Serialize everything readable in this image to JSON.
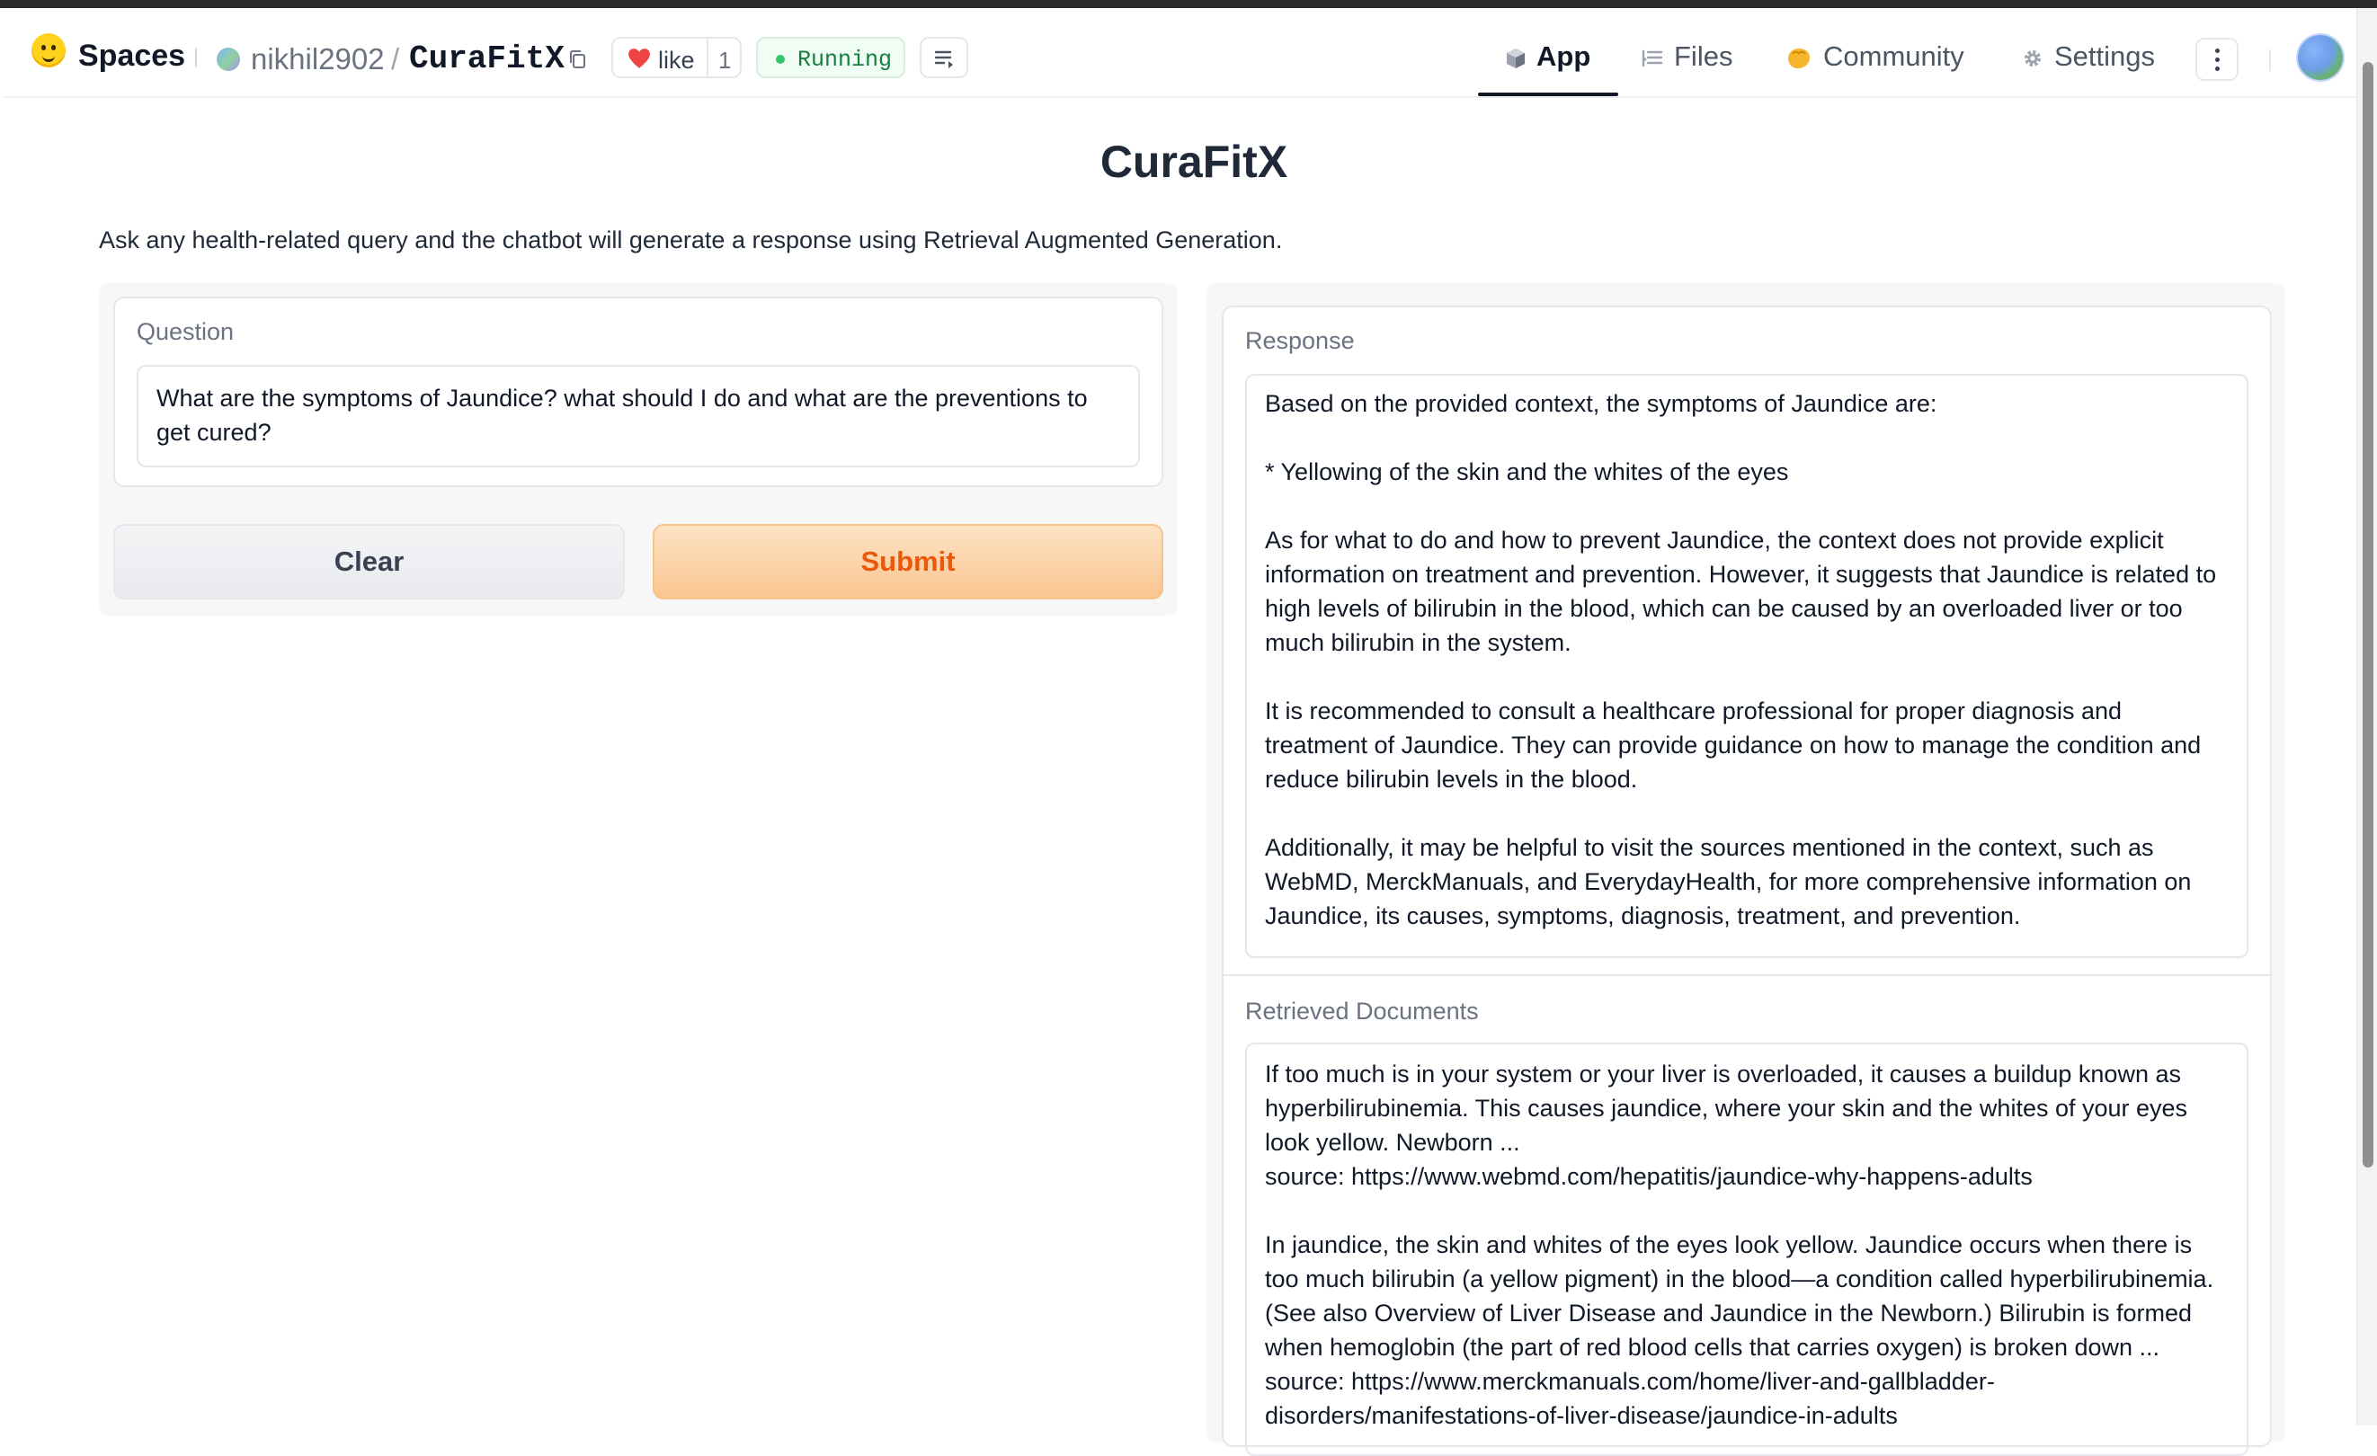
{
  "header": {
    "spaces_label": "Spaces",
    "owner": "nikhil2902",
    "separator": "/",
    "repo": "CuraFitX",
    "like_label": "like",
    "like_count": "1",
    "status": "Running",
    "nav": {
      "app": "App",
      "files": "Files",
      "community": "Community",
      "settings": "Settings"
    }
  },
  "main": {
    "title": "CuraFitX",
    "description": "Ask any health-related query and the chatbot will generate a response using Retrieval Augmented Generation.",
    "question": {
      "label": "Question",
      "value": "What are the symptoms of Jaundice? what should I do and what are the preventions to get cured?"
    },
    "buttons": {
      "clear": "Clear",
      "submit": "Submit"
    },
    "response": {
      "label": "Response",
      "paragraphs": [
        "Based on the provided context, the symptoms of Jaundice are:",
        "* Yellowing of the skin and the whites of the eyes",
        "As for what to do and how to prevent Jaundice, the context does not provide explicit information on treatment and prevention. However, it suggests that Jaundice is related to high levels of bilirubin in the blood, which can be caused by an overloaded liver or too much bilirubin in the system.",
        "It is recommended to consult a healthcare professional for proper diagnosis and treatment of Jaundice. They can provide guidance on how to manage the condition and reduce bilirubin levels in the blood.",
        "Additionally, it may be helpful to visit the sources mentioned in the context, such as WebMD, MerckManuals, and EverydayHealth, for more comprehensive information on Jaundice, its causes, symptoms, diagnosis, treatment, and prevention."
      ]
    },
    "retrieved": {
      "label": "Retrieved Documents",
      "docs": [
        {
          "text": "If too much is in your system or your liver is overloaded, it causes a buildup known as hyperbilirubinemia. This causes jaundice, where your skin and the whites of your eyes look yellow. Newborn ...",
          "source": "source: https://www.webmd.com/hepatitis/jaundice-why-happens-adults"
        },
        {
          "text": "In jaundice, the skin and whites of the eyes look yellow. Jaundice occurs when there is too much bilirubin (a yellow pigment) in the blood—a condition called hyperbilirubinemia. (See also Overview of Liver Disease and Jaundice in the Newborn.) Bilirubin is formed when hemoglobin (the part of red blood cells that carries oxygen) is broken down ...",
          "source": "source: https://www.merckmanuals.com/home/liver-and-gallbladder-disorders/manifestations-of-liver-disease/jaundice-in-adults"
        }
      ]
    }
  },
  "icons": {
    "logo": "hugging-face-logo-icon",
    "copy": "copy-icon",
    "heart": "heart-icon",
    "logs": "logs-icon",
    "app": "cube-icon",
    "files": "files-icon",
    "community": "community-icon",
    "settings": "gear-icon",
    "more": "kebab-menu-icon"
  },
  "colors": {
    "accent_orange": "#ea580c",
    "running_green": "#34c46a",
    "heart_red": "#ef4444"
  }
}
